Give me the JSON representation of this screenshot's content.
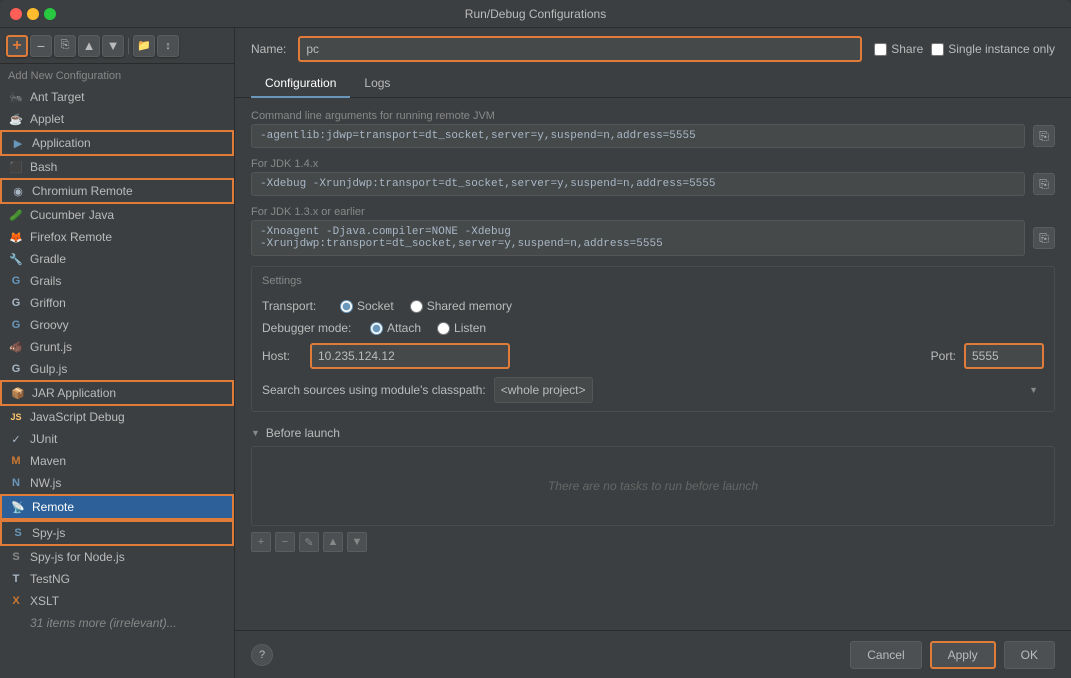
{
  "window": {
    "title": "Run/Debug Configurations"
  },
  "header": {
    "name_label": "Name:",
    "name_value": "pc",
    "share_label": "Share",
    "single_instance_label": "Single instance only"
  },
  "tabs": {
    "configuration_label": "Configuration",
    "logs_label": "Logs"
  },
  "sidebar": {
    "add_new_label": "Add New Configuration",
    "items": [
      {
        "id": "ant-target",
        "label": "Ant Target",
        "icon": "🐜",
        "icon_class": "icon-ant"
      },
      {
        "id": "applet",
        "label": "Applet",
        "icon": "☕",
        "icon_class": "icon-applet"
      },
      {
        "id": "application",
        "label": "Application",
        "icon": "▶",
        "icon_class": "icon-application",
        "highlighted": true
      },
      {
        "id": "bash",
        "label": "Bash",
        "icon": "⬛",
        "icon_class": "icon-bash"
      },
      {
        "id": "chromium-remote",
        "label": "Chromium Remote",
        "icon": "◉",
        "icon_class": "icon-chromium",
        "highlighted": true
      },
      {
        "id": "cucumber-java",
        "label": "Cucumber Java",
        "icon": "🥒",
        "icon_class": "icon-cucumber"
      },
      {
        "id": "firefox-remote",
        "label": "Firefox Remote",
        "icon": "🦊",
        "icon_class": "icon-firefox"
      },
      {
        "id": "gradle",
        "label": "Gradle",
        "icon": "🔧",
        "icon_class": "icon-gradle"
      },
      {
        "id": "grails",
        "label": "Grails",
        "icon": "G",
        "icon_class": "icon-grails"
      },
      {
        "id": "griffon",
        "label": "Griffon",
        "icon": "G",
        "icon_class": "icon-griffon"
      },
      {
        "id": "groovy",
        "label": "Groovy",
        "icon": "G",
        "icon_class": "icon-groovy"
      },
      {
        "id": "grunt-js",
        "label": "Grunt.js",
        "icon": "🐗",
        "icon_class": "icon-grunt"
      },
      {
        "id": "gulp-js",
        "label": "Gulp.js",
        "icon": "G",
        "icon_class": "icon-gulp"
      },
      {
        "id": "jar-application",
        "label": "JAR Application",
        "icon": "📦",
        "icon_class": "icon-jar",
        "highlighted": true
      },
      {
        "id": "javascript-debug",
        "label": "JavaScript Debug",
        "icon": "JS",
        "icon_class": "icon-js"
      },
      {
        "id": "junit",
        "label": "JUnit",
        "icon": "✓",
        "icon_class": "icon-junit"
      },
      {
        "id": "maven",
        "label": "Maven",
        "icon": "M",
        "icon_class": "icon-maven"
      },
      {
        "id": "nw-js",
        "label": "NW.js",
        "icon": "N",
        "icon_class": "icon-nw"
      },
      {
        "id": "remote",
        "label": "Remote",
        "icon": "📡",
        "icon_class": "icon-remote",
        "selected": true
      },
      {
        "id": "spy-js",
        "label": "Spy-js",
        "icon": "S",
        "icon_class": "icon-spy",
        "highlighted": true
      },
      {
        "id": "spy-js-node",
        "label": "Spy-js for Node.js",
        "icon": "S",
        "icon_class": "icon-spy"
      },
      {
        "id": "testng",
        "label": "TestNG",
        "icon": "T",
        "icon_class": "icon-testng"
      },
      {
        "id": "xslt",
        "label": "XSLT",
        "icon": "X",
        "icon_class": "icon-xslt"
      },
      {
        "id": "more-items",
        "label": "31 items more (irrelevant)...",
        "icon": "",
        "icon_class": ""
      }
    ]
  },
  "configuration": {
    "cmd_label": "Command line arguments for running remote JVM",
    "cmd_value": "-agentlib:jdwp=transport=dt_socket,server=y,suspend=n,address=5555",
    "jdk14_label": "For JDK 1.4.x",
    "jdk14_value": "-Xdebug -Xrunjdwp:transport=dt_socket,server=y,suspend=n,address=5555",
    "jdk13_label": "For JDK 1.3.x or earlier",
    "jdk13_value": "-Xnoagent -Djava.compiler=NONE -Xdebug\n-Xrunjdwp:transport=dt_socket,server=y,suspend=n,address=5555",
    "settings_label": "Settings",
    "transport_label": "Transport:",
    "socket_label": "Socket",
    "shared_memory_label": "Shared memory",
    "debugger_mode_label": "Debugger mode:",
    "attach_label": "Attach",
    "listen_label": "Listen",
    "host_label": "Host:",
    "host_value": "10.235.124.12",
    "port_label": "Port:",
    "port_value": "5555",
    "module_label": "Search sources using module's classpath:",
    "module_value": "<whole project>",
    "before_launch_label": "Before launch",
    "no_tasks_text": "There are no tasks to run before launch"
  },
  "bottom": {
    "cancel_label": "Cancel",
    "apply_label": "Apply",
    "ok_label": "OK"
  }
}
